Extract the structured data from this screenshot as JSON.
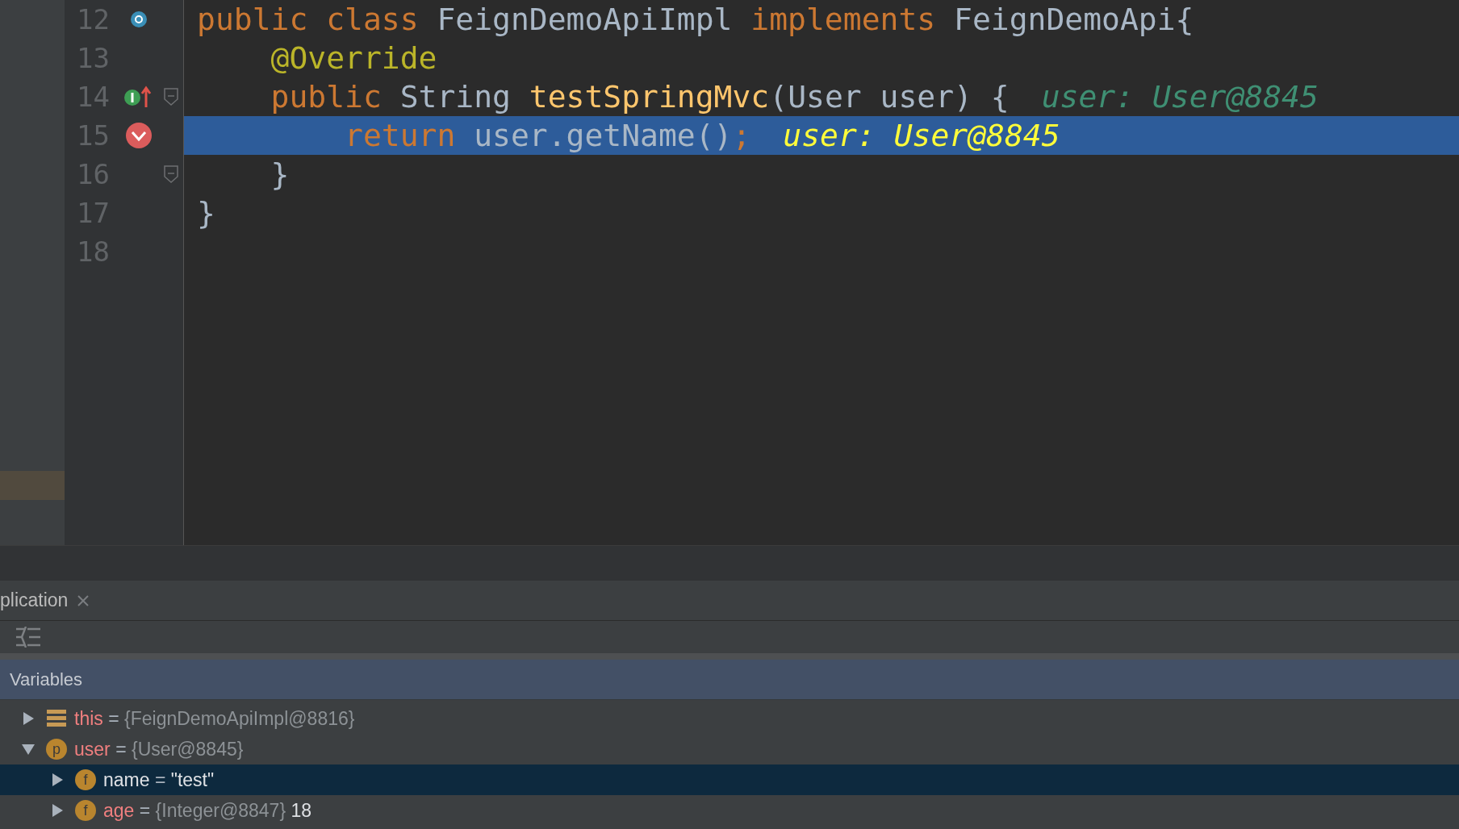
{
  "editor": {
    "lines": [
      {
        "number": "12",
        "marker": {
          "kind": "class"
        },
        "fold": false,
        "selected": false,
        "tokens": [
          {
            "text": "public class ",
            "kind": "keyword"
          },
          {
            "text": "FeignDemoApiImpl ",
            "kind": "plain"
          },
          {
            "text": "implements ",
            "kind": "keyword"
          },
          {
            "text": "FeignDemoApi{",
            "kind": "plain"
          }
        ]
      },
      {
        "number": "13",
        "fold": false,
        "selected": false,
        "tokens": [
          {
            "text": "    @Override",
            "kind": "annotation"
          }
        ]
      },
      {
        "number": "14",
        "marker": {
          "kind": "implements"
        },
        "fold": true,
        "selected": false,
        "tokens": [
          {
            "text": "    public ",
            "kind": "keyword"
          },
          {
            "text": "String ",
            "kind": "plain"
          },
          {
            "text": "testSpringMvc",
            "kind": "method"
          },
          {
            "text": "(User user) {",
            "kind": "plain"
          }
        ],
        "hint": "user: User@8845"
      },
      {
        "number": "15",
        "marker": {
          "kind": "breakpoint"
        },
        "fold": false,
        "selected": true,
        "tokens": [
          {
            "text": "        return ",
            "kind": "keyword"
          },
          {
            "text": "user.getName()",
            "kind": "plain"
          },
          {
            "text": ";",
            "kind": "keyword"
          }
        ],
        "hint": "user: User@8845"
      },
      {
        "number": "16",
        "fold": true,
        "selected": false,
        "tokens": [
          {
            "text": "    }",
            "kind": "plain"
          }
        ]
      },
      {
        "number": "17",
        "fold": false,
        "selected": false,
        "tokens": [
          {
            "text": "}",
            "kind": "plain"
          }
        ]
      },
      {
        "number": "18",
        "fold": false,
        "selected": false
      }
    ]
  },
  "debug_tab": {
    "label": "plication"
  },
  "variables": {
    "title": "Variables",
    "items": [
      {
        "kind": "object",
        "name": "this",
        "operator": "=",
        "ref": "{FeignDemoApiImpl@8816}",
        "expanded": false,
        "selected": false
      },
      {
        "kind": "param",
        "badge": "p",
        "name": "user",
        "operator": "=",
        "ref": "{User@8845}",
        "expanded": true,
        "selected": false,
        "children": [
          {
            "kind": "field",
            "badge": "f",
            "name": "name",
            "operator": "=",
            "value": "\"test\"",
            "expanded": false,
            "selected": true
          },
          {
            "kind": "field",
            "badge": "f",
            "name": "age",
            "operator": "=",
            "ref": "{Integer@8847}",
            "value": "18",
            "expanded": false,
            "selected": false
          }
        ]
      }
    ]
  }
}
